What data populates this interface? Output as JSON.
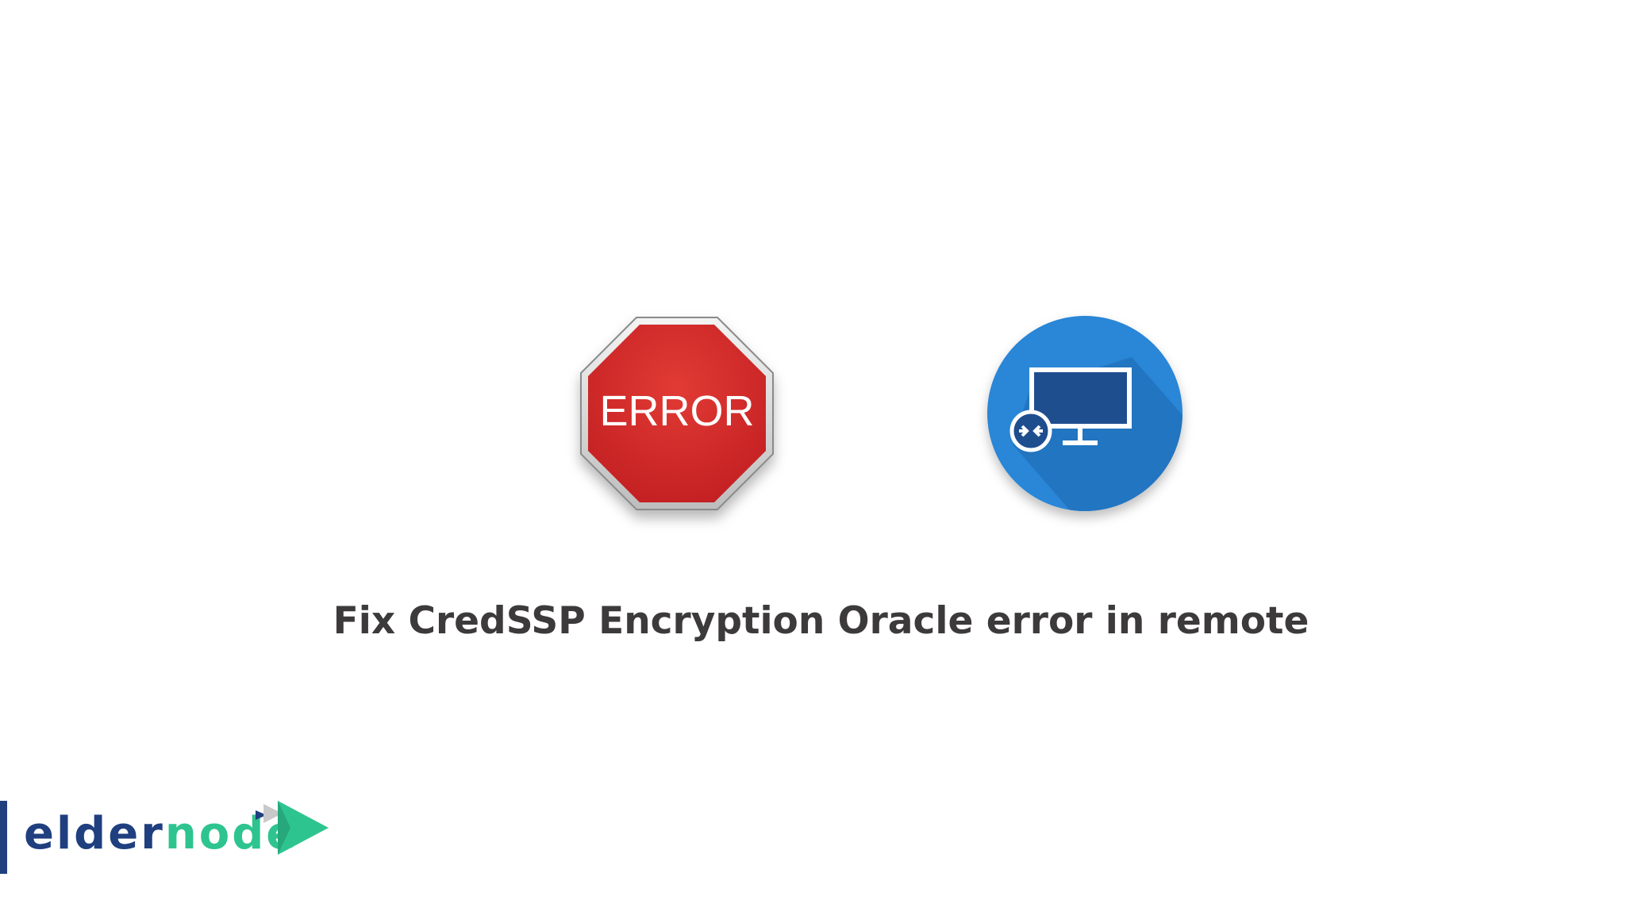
{
  "error_sign": {
    "label": "ERROR",
    "colors": {
      "fill": "#d42a2a",
      "rim": "#e9e9e9",
      "text": "#ffffff"
    }
  },
  "remote_desktop_icon": {
    "icon": "remote-desktop-monitor-icon",
    "colors": {
      "circle": "#2a86d6",
      "monitor": "#1f4e8f",
      "stroke": "#ffffff"
    }
  },
  "headline": {
    "text": "Fix CredSSP Encryption Oracle error in remote",
    "color": "#3d3a3c"
  },
  "logo": {
    "part1": "elder",
    "part2": "node",
    "colors": {
      "part1": "#1f3f7f",
      "part2": "#2ec48f"
    }
  }
}
